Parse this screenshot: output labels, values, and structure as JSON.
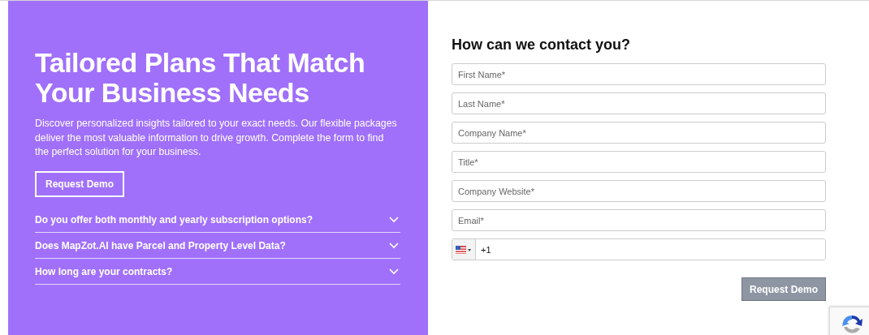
{
  "hero": {
    "title": "Tailored Plans That Match Your Business Needs",
    "description": "Discover personalized insights tailored to your exact needs. Our flexible packages deliver the most valuable information to drive growth. Complete the form to find the perfect solution for your business.",
    "button": "Request Demo"
  },
  "faqs": [
    {
      "question": "Do you offer both monthly and yearly subscription options?",
      "expanded": false
    },
    {
      "question": "Does MapZot.AI have Parcel and Property Level Data?",
      "expanded": false
    },
    {
      "question": "How long are your contracts?",
      "expanded": false
    }
  ],
  "form": {
    "heading": "How can we contact you?",
    "fields": [
      {
        "placeholder": "First Name*"
      },
      {
        "placeholder": "Last Name*"
      },
      {
        "placeholder": "Company Name*"
      },
      {
        "placeholder": "Title*"
      },
      {
        "placeholder": "Company Website*"
      },
      {
        "placeholder": "Email*"
      }
    ],
    "phone": {
      "value": "+1"
    },
    "submit": "Request Demo"
  }
}
